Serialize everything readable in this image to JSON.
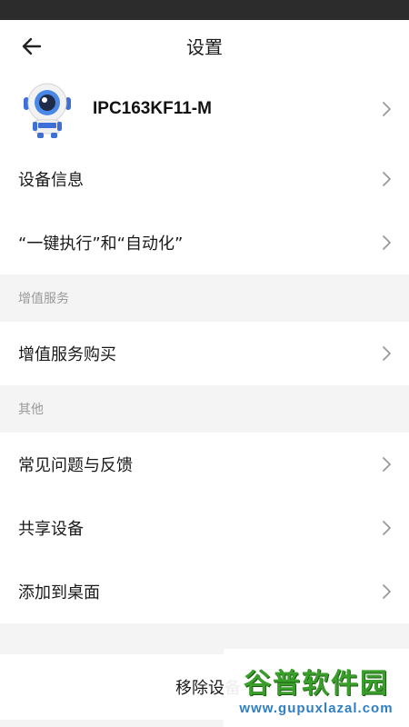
{
  "header": {
    "title": "设置"
  },
  "device": {
    "name": "IPC163KF11-M"
  },
  "rows_main": [
    {
      "label": "设备信息"
    },
    {
      "label": "“一键执行”和“自动化”"
    }
  ],
  "section_value_added": {
    "title": "增值服务",
    "items": [
      {
        "label": "增值服务购买"
      }
    ]
  },
  "section_other": {
    "title": "其他",
    "items": [
      {
        "label": "常见问题与反馈"
      },
      {
        "label": "共享设备"
      },
      {
        "label": "添加到桌面"
      }
    ]
  },
  "remove": {
    "label": "移除设备"
  },
  "watermark": {
    "title": "谷普软件园",
    "url": "www.gupuxlazal.com"
  },
  "colors": {
    "status_bar": "#2c2c2c",
    "background": "#f4f4f4",
    "watermark_green": "#3a9e2a",
    "watermark_blue": "#2f7fc4"
  },
  "icons": {
    "back": "arrow-left-icon",
    "chevron": "chevron-right-icon",
    "device": "robot-camera-mascot"
  }
}
